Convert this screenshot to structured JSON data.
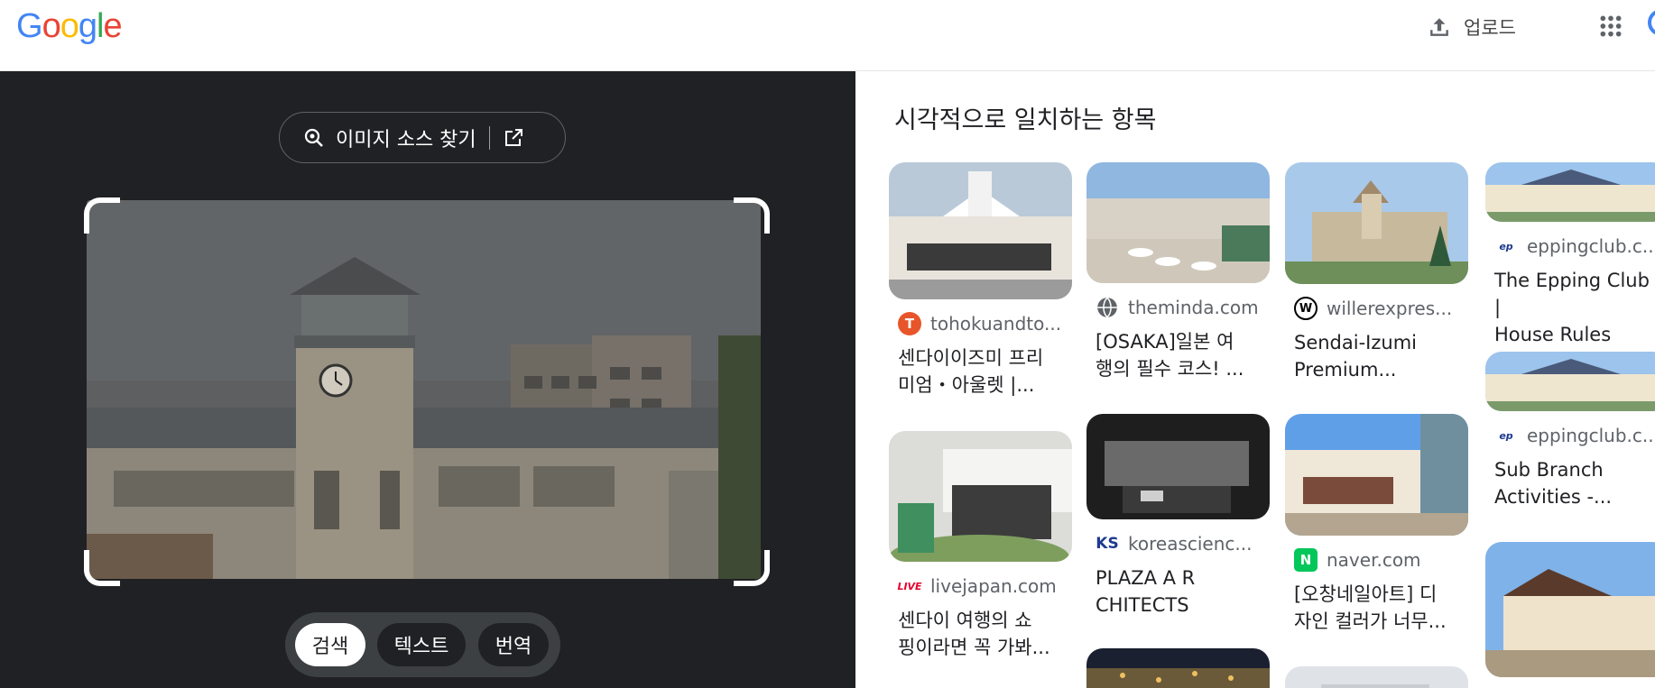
{
  "header": {
    "logo_letters": [
      {
        "ch": "G",
        "color": "#4285f4"
      },
      {
        "ch": "o",
        "color": "#ea4335"
      },
      {
        "ch": "o",
        "color": "#fbbc05"
      },
      {
        "ch": "g",
        "color": "#4285f4"
      },
      {
        "ch": "l",
        "color": "#34a853"
      },
      {
        "ch": "e",
        "color": "#ea4335"
      }
    ],
    "upload_label": "업로드",
    "upload_icon": "upload-icon",
    "apps_icon": "apps-grid-icon"
  },
  "lens": {
    "find_source_label": "이미지 소스 찾기",
    "find_source_icon": "lens-search-icon",
    "open_external_icon": "open-in-new-icon",
    "modes": [
      {
        "label": "검색",
        "active": true
      },
      {
        "label": "텍스트",
        "active": false
      },
      {
        "label": "번역",
        "active": false
      }
    ]
  },
  "results": {
    "title": "시각적으로 일치하는 항목",
    "cards": [
      {
        "source": "tohokuandto...",
        "title_lines": [
          "센다이이즈미 프리",
          "미엄・아울렛 |..."
        ],
        "favicon": "T",
        "favicon_color": "#e8552a"
      },
      {
        "source": "livejapan.com",
        "title_lines": [
          "센다이 여행의 쇼",
          "핑이라면 꼭 가봐..."
        ],
        "favicon": "LIVE",
        "favicon_color": "#ffffff"
      },
      {
        "source": "theminda.com",
        "title_lines": [
          "[OSAKA]일본 여",
          "행의 필수 코스! ..."
        ],
        "favicon": "globe",
        "favicon_color": "#5f6368"
      },
      {
        "source": "koreascienc...",
        "title_lines": [
          "PLAZA A R",
          "CHITECTS"
        ],
        "favicon": "KS",
        "favicon_color": "#ffffff"
      },
      {
        "source": "willerexpres...",
        "title_lines": [
          "Sendai-Izumi",
          "Premium..."
        ],
        "favicon": "W",
        "favicon_color": "#000000"
      },
      {
        "source": "naver.com",
        "title_lines": [
          "[오창네일아트] 디",
          "자인 컬러가 너무..."
        ],
        "favicon": "N",
        "favicon_color": "#03c75a"
      },
      {
        "source": "eppingclub.c...",
        "title_lines": [
          "The Epping Club |",
          "House Rules"
        ],
        "favicon": "ep",
        "favicon_color": "#ffffff"
      },
      {
        "source": "eppingclub.c...",
        "title_lines": [
          "Sub Branch",
          "Activities -..."
        ],
        "favicon": "ep",
        "favicon_color": "#ffffff"
      }
    ]
  }
}
